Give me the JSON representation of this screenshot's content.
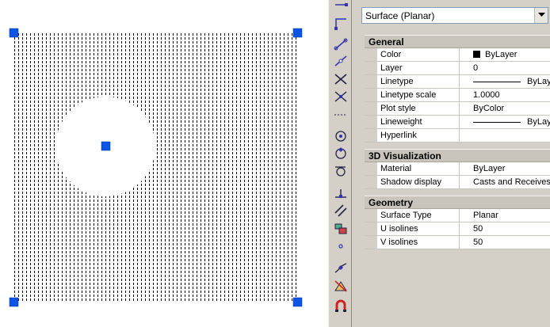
{
  "colors": {
    "grip": "#0a55e6",
    "panel": "#d4d0c8",
    "section_header": "#c9c5bc"
  },
  "toolbar": {
    "tools": [
      "line-icon",
      "polyline-icon",
      "construction-line-icon",
      "ray-icon",
      "intersection-icon",
      "apparent-intersection-icon",
      "extension-icon",
      "center-icon",
      "quadrant-icon",
      "tangent-icon",
      "perpendicular-icon",
      "parallel-icon",
      "insert-icon",
      "node-icon",
      "nearest-icon",
      "snap-none-icon",
      "osnap-settings-icon"
    ]
  },
  "properties": {
    "selected_object": "Surface (Planar)",
    "sections": [
      {
        "title": "General",
        "rows": [
          {
            "label": "Color",
            "value": "ByLayer",
            "swatch": true
          },
          {
            "label": "Layer",
            "value": "0"
          },
          {
            "label": "Linetype",
            "value": "ByLayer",
            "line": true
          },
          {
            "label": "Linetype scale",
            "value": "1.0000"
          },
          {
            "label": "Plot style",
            "value": "ByColor"
          },
          {
            "label": "Lineweight",
            "value": "ByLayer",
            "line": true
          },
          {
            "label": "Hyperlink",
            "value": ""
          }
        ]
      },
      {
        "title": "3D Visualization",
        "rows": [
          {
            "label": "Material",
            "value": "ByLayer"
          },
          {
            "label": "Shadow display",
            "value": "Casts and Receives"
          }
        ]
      },
      {
        "title": "Geometry",
        "rows": [
          {
            "label": "Surface Type",
            "value": "Planar"
          },
          {
            "label": "U isolines",
            "value": "50"
          },
          {
            "label": "V isolines",
            "value": "50"
          }
        ]
      }
    ]
  }
}
